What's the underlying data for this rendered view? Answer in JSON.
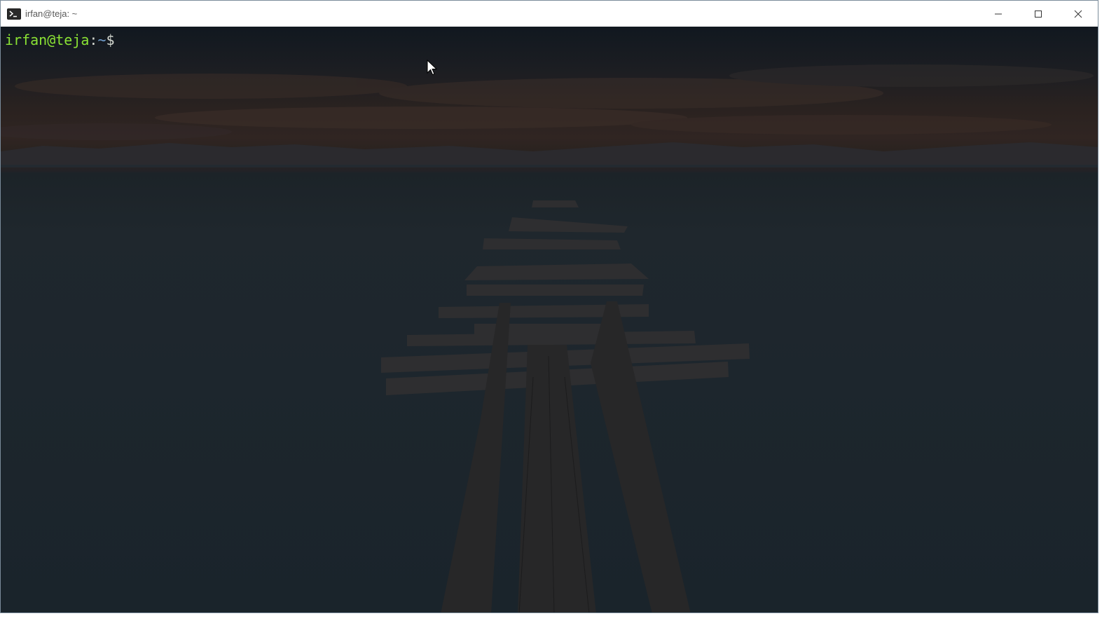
{
  "window": {
    "title": "irfan@teja: ~",
    "app_icon": "terminal-icon",
    "controls": [
      "minimize-icon",
      "maximize-icon",
      "close-icon"
    ]
  },
  "terminal": {
    "prompt": {
      "user_host": "irfan@teja",
      "separator": ":",
      "path": "~",
      "symbol": "$"
    },
    "colors": {
      "user_host": "#8ae234",
      "path": "#729fcf",
      "text": "#d3d7cf"
    },
    "background_image": "dark lake with broken wooden pier under cloudy sky"
  },
  "pointer": "mouse-pointer-icon"
}
